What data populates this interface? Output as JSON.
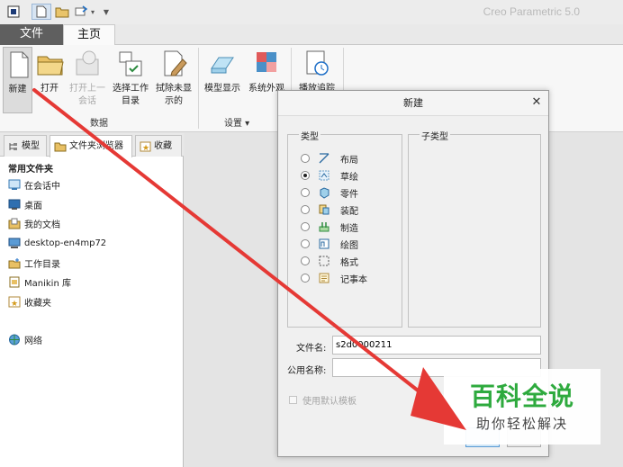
{
  "titlebar": {
    "app_title": "Creo Parametric 5.0"
  },
  "tabs": {
    "file": "文件",
    "home": "主页"
  },
  "ribbon": {
    "buttons": {
      "new": "新建",
      "open": "打开",
      "open_last_1": "打开上一",
      "open_last_2": "会话",
      "select_dir_1": "选择工作",
      "select_dir_2": "目录",
      "erase_1": "拭除未显",
      "erase_2": "示的",
      "model_display": "模型显示",
      "system_appearance": "系统外观",
      "playback": "播放追踪"
    },
    "groups": {
      "data": "数据",
      "settings": "设置 ▾"
    }
  },
  "left_pane": {
    "tabs": {
      "model_tree": "模型",
      "browser": "文件夹浏览器",
      "favorites": "收藏"
    },
    "common_folders_title": "常用文件夹",
    "folders": [
      "在会话中",
      "桌面",
      "我的文档",
      "desktop-en4mp72",
      "工作目录",
      "Manikin 库",
      "收藏夹"
    ],
    "network": "网络"
  },
  "dialog": {
    "title": "新建",
    "type_label": "类型",
    "subtype_label": "子类型",
    "types": [
      {
        "label": "布局",
        "selected": false,
        "icon": "layout-icon"
      },
      {
        "label": "草绘",
        "selected": true,
        "icon": "sketch-icon"
      },
      {
        "label": "零件",
        "selected": false,
        "icon": "part-icon"
      },
      {
        "label": "装配",
        "selected": false,
        "icon": "assembly-icon"
      },
      {
        "label": "制造",
        "selected": false,
        "icon": "manufacturing-icon"
      },
      {
        "label": "绘图",
        "selected": false,
        "icon": "drawing-icon"
      },
      {
        "label": "格式",
        "selected": false,
        "icon": "format-icon"
      },
      {
        "label": "记事本",
        "selected": false,
        "icon": "notebook-icon"
      }
    ],
    "filename_label": "文件名:",
    "filename_value": "s2d0000211",
    "common_name_label": "公用名称:",
    "common_name_value": "",
    "use_template_label": "使用默认模板"
  },
  "watermark": {
    "title": "百科全说",
    "subtitle": "助你轻松解决"
  },
  "colors": {
    "annotation_arrow": "#e53935",
    "watermark_green": "#2eaa3e",
    "file_tab": "#5f5f5f"
  }
}
